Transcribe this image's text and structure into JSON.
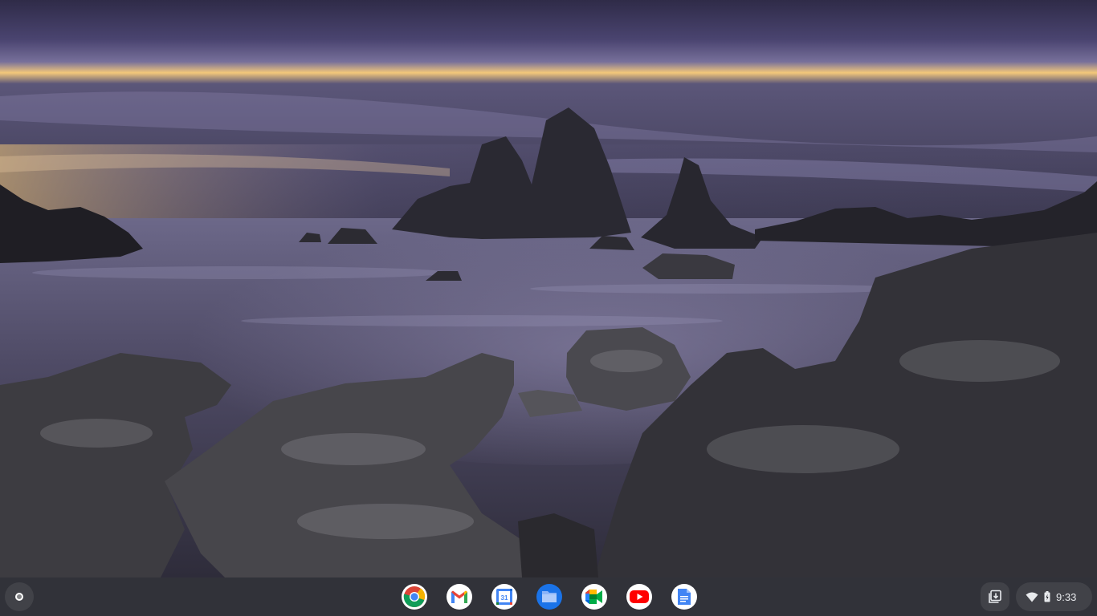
{
  "wallpaper": {
    "description_colors": {
      "sky_top": "#3a3558",
      "sky_mid": "#6a6390",
      "sunset": "#f2c77a",
      "water": "#5b5778",
      "rock": "#2b2a2e"
    }
  },
  "shelf": {
    "launcher": {
      "icon": "launcher-icon"
    },
    "apps": [
      {
        "id": "chrome",
        "icon": "chrome-icon"
      },
      {
        "id": "gmail",
        "icon": "gmail-icon"
      },
      {
        "id": "calendar",
        "icon": "calendar-icon",
        "label": "31"
      },
      {
        "id": "files",
        "icon": "files-icon"
      },
      {
        "id": "meet",
        "icon": "meet-icon"
      },
      {
        "id": "youtube",
        "icon": "youtube-icon"
      },
      {
        "id": "docs",
        "icon": "docs-icon"
      }
    ],
    "holding_space": {
      "icon": "holding-space-icon"
    },
    "status": {
      "wifi_icon": "wifi-icon",
      "battery_icon": "battery-icon",
      "time": "9:33"
    }
  }
}
